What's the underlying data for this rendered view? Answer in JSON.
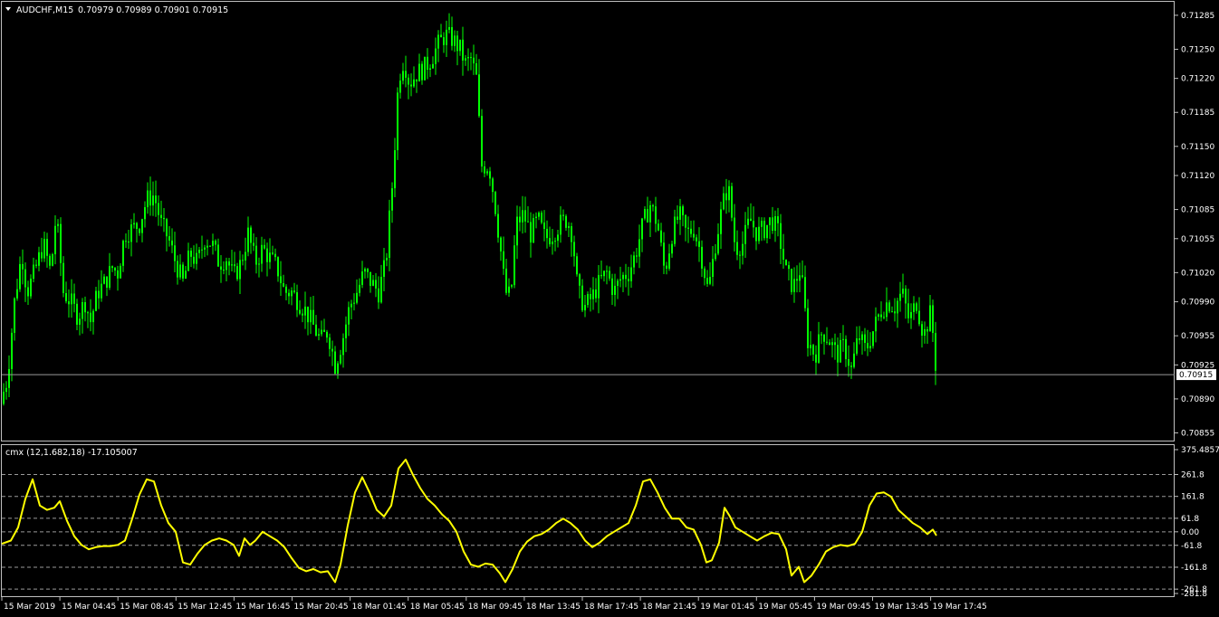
{
  "window": {
    "symbol_title": "AUDCHF,M15",
    "ohlc": "0.70979 0.70989 0.70901 0.70915",
    "indicator_title": "cmx (12,1.682,18) -17.105007"
  },
  "colors": {
    "background": "#000000",
    "candles": "#00ff00",
    "indicator_line": "#ffff00",
    "grid": "#9a9a9a",
    "axis": "#c0c0c0",
    "price_line": "#9a9a9a"
  },
  "chart_data": [
    {
      "type": "candlestick",
      "title": "AUDCHF,M15",
      "current_price": 0.70915,
      "current_price_label": "0.70915",
      "ylim": [
        0.70848,
        0.71297
      ],
      "yticks": [
        "0.71285",
        "0.71250",
        "0.71220",
        "0.71185",
        "0.71150",
        "0.71120",
        "0.71085",
        "0.71055",
        "0.71020",
        "0.70990",
        "0.70955",
        "0.70925",
        "0.70890",
        "0.70855"
      ],
      "xlabels": [
        "15 Mar 2019",
        "15 Mar 04:45",
        "15 Mar 08:45",
        "15 Mar 12:45",
        "15 Mar 16:45",
        "15 Mar 20:45",
        "18 Mar 01:45",
        "18 Mar 05:45",
        "18 Mar 09:45",
        "18 Mar 13:45",
        "18 Mar 17:45",
        "18 Mar 21:45",
        "19 Mar 01:45",
        "19 Mar 05:45",
        "19 Mar 09:45",
        "19 Mar 13:45",
        "19 Mar 17:45"
      ],
      "close_path": [
        [
          0,
          0.70885
        ],
        [
          8,
          0.7091
        ],
        [
          16,
          0.7099
        ],
        [
          24,
          0.7104
        ],
        [
          30,
          0.71
        ],
        [
          38,
          0.7102
        ],
        [
          48,
          0.7105
        ],
        [
          56,
          0.7102
        ],
        [
          62,
          0.7108
        ],
        [
          70,
          0.71
        ],
        [
          78,
          0.7099
        ],
        [
          86,
          0.70975
        ],
        [
          94,
          0.7099
        ],
        [
          100,
          0.7097
        ],
        [
          108,
          0.71
        ],
        [
          116,
          0.7101
        ],
        [
          124,
          0.71025
        ],
        [
          130,
          0.7102
        ],
        [
          138,
          0.7106
        ],
        [
          146,
          0.71065
        ],
        [
          154,
          0.7107
        ],
        [
          162,
          0.71095
        ],
        [
          170,
          0.711
        ],
        [
          178,
          0.7107
        ],
        [
          186,
          0.71055
        ],
        [
          194,
          0.7103
        ],
        [
          202,
          0.7101
        ],
        [
          210,
          0.7104
        ],
        [
          218,
          0.7103
        ],
        [
          226,
          0.71055
        ],
        [
          234,
          0.7105
        ],
        [
          242,
          0.7103
        ],
        [
          250,
          0.71035
        ],
        [
          258,
          0.71015
        ],
        [
          266,
          0.7103
        ],
        [
          274,
          0.7106
        ],
        [
          282,
          0.7103
        ],
        [
          290,
          0.71045
        ],
        [
          298,
          0.71035
        ],
        [
          306,
          0.71025
        ],
        [
          314,
          0.71
        ],
        [
          322,
          0.71
        ],
        [
          330,
          0.7099
        ],
        [
          338,
          0.7098
        ],
        [
          346,
          0.70965
        ],
        [
          354,
          0.7095
        ],
        [
          362,
          0.7096
        ],
        [
          370,
          0.70925
        ],
        [
          378,
          0.7095
        ],
        [
          386,
          0.70985
        ],
        [
          394,
          0.71
        ],
        [
          402,
          0.7102
        ],
        [
          410,
          0.7101
        ],
        [
          418,
          0.71
        ],
        [
          426,
          0.7103
        ],
        [
          434,
          0.7112
        ],
        [
          440,
          0.7122
        ],
        [
          446,
          0.7124
        ],
        [
          452,
          0.71215
        ],
        [
          460,
          0.71225
        ],
        [
          468,
          0.7123
        ],
        [
          476,
          0.7124
        ],
        [
          484,
          0.71255
        ],
        [
          492,
          0.71265
        ],
        [
          500,
          0.7126
        ],
        [
          508,
          0.7125
        ],
        [
          514,
          0.71235
        ],
        [
          520,
          0.7124
        ],
        [
          526,
          0.7122
        ],
        [
          532,
          0.7113
        ],
        [
          540,
          0.7113
        ],
        [
          546,
          0.71095
        ],
        [
          552,
          0.7105
        ],
        [
          558,
          0.71
        ],
        [
          564,
          0.70995
        ],
        [
          570,
          0.7107
        ],
        [
          578,
          0.7108
        ],
        [
          586,
          0.7106
        ],
        [
          594,
          0.71075
        ],
        [
          602,
          0.71055
        ],
        [
          610,
          0.7106
        ],
        [
          618,
          0.7107
        ],
        [
          626,
          0.71075
        ],
        [
          632,
          0.7106
        ],
        [
          638,
          0.71
        ],
        [
          646,
          0.70985
        ],
        [
          654,
          0.70995
        ],
        [
          662,
          0.7101
        ],
        [
          670,
          0.7102
        ],
        [
          678,
          0.71
        ],
        [
          686,
          0.71015
        ],
        [
          694,
          0.7102
        ],
        [
          702,
          0.7104
        ],
        [
          710,
          0.7107
        ],
        [
          718,
          0.7109
        ],
        [
          726,
          0.7107
        ],
        [
          734,
          0.7102
        ],
        [
          742,
          0.7106
        ],
        [
          750,
          0.7108
        ],
        [
          758,
          0.7106
        ],
        [
          766,
          0.71065
        ],
        [
          774,
          0.7104
        ],
        [
          782,
          0.71
        ],
        [
          790,
          0.7105
        ],
        [
          798,
          0.7109
        ],
        [
          804,
          0.7111
        ],
        [
          812,
          0.71045
        ],
        [
          820,
          0.7105
        ],
        [
          828,
          0.71075
        ],
        [
          836,
          0.7106
        ],
        [
          844,
          0.71065
        ],
        [
          852,
          0.71075
        ],
        [
          860,
          0.7106
        ],
        [
          868,
          0.7102
        ],
        [
          876,
          0.71005
        ],
        [
          884,
          0.71025
        ],
        [
          892,
          0.7095
        ],
        [
          900,
          0.70935
        ],
        [
          908,
          0.7096
        ],
        [
          916,
          0.7095
        ],
        [
          924,
          0.70935
        ],
        [
          932,
          0.70945
        ],
        [
          940,
          0.7092
        ],
        [
          948,
          0.70955
        ],
        [
          956,
          0.7094
        ],
        [
          964,
          0.7096
        ],
        [
          972,
          0.7098
        ],
        [
          980,
          0.7099
        ],
        [
          988,
          0.70985
        ],
        [
          996,
          0.71
        ],
        [
          1004,
          0.7097
        ],
        [
          1012,
          0.7099
        ],
        [
          1020,
          0.70955
        ],
        [
          1028,
          0.7098
        ],
        [
          1034,
          0.70915
        ]
      ]
    },
    {
      "type": "line",
      "title": "cmx (12,1.682,18) -17.105007",
      "current_value": -17.105007,
      "ylim": [
        -281.8,
        375.4857
      ],
      "yticks": [
        "375.48570",
        "261.8",
        "161.8",
        "61.8",
        "0.00",
        "-61.8",
        "-161.8",
        "-261.8",
        "-281.8"
      ],
      "levels": [
        261.8,
        161.8,
        61.8,
        0,
        -61.8,
        -161.8,
        -261.8
      ],
      "series": [
        {
          "values": [
            [
              2,
              -55
            ],
            [
              12,
              -40
            ],
            [
              20,
              20
            ],
            [
              28,
              150
            ],
            [
              36,
              240
            ],
            [
              44,
              120
            ],
            [
              52,
              100
            ],
            [
              60,
              110
            ],
            [
              66,
              140
            ],
            [
              74,
              50
            ],
            [
              82,
              -20
            ],
            [
              90,
              -60
            ],
            [
              98,
              -80
            ],
            [
              106,
              -70
            ],
            [
              114,
              -65
            ],
            [
              122,
              -65
            ],
            [
              130,
              -60
            ],
            [
              138,
              -40
            ],
            [
              146,
              60
            ],
            [
              154,
              170
            ],
            [
              162,
              240
            ],
            [
              170,
              230
            ],
            [
              178,
              120
            ],
            [
              186,
              40
            ],
            [
              194,
              0
            ],
            [
              202,
              -140
            ],
            [
              210,
              -150
            ],
            [
              218,
              -100
            ],
            [
              226,
              -60
            ],
            [
              234,
              -40
            ],
            [
              242,
              -30
            ],
            [
              250,
              -40
            ],
            [
              258,
              -60
            ],
            [
              264,
              -110
            ],
            [
              270,
              -30
            ],
            [
              276,
              -60
            ],
            [
              282,
              -40
            ],
            [
              290,
              0
            ],
            [
              298,
              -20
            ],
            [
              306,
              -40
            ],
            [
              314,
              -70
            ],
            [
              322,
              -120
            ],
            [
              330,
              -165
            ],
            [
              338,
              -180
            ],
            [
              346,
              -170
            ],
            [
              354,
              -185
            ],
            [
              362,
              -180
            ],
            [
              370,
              -230
            ],
            [
              376,
              -150
            ],
            [
              384,
              30
            ],
            [
              392,
              180
            ],
            [
              400,
              250
            ],
            [
              408,
              180
            ],
            [
              416,
              100
            ],
            [
              424,
              70
            ],
            [
              432,
              120
            ],
            [
              440,
              290
            ],
            [
              448,
              330
            ],
            [
              456,
              260
            ],
            [
              464,
              200
            ],
            [
              472,
              150
            ],
            [
              480,
              120
            ],
            [
              488,
              80
            ],
            [
              496,
              50
            ],
            [
              504,
              0
            ],
            [
              512,
              -90
            ],
            [
              520,
              -150
            ],
            [
              528,
              -160
            ],
            [
              536,
              -145
            ],
            [
              544,
              -150
            ],
            [
              552,
              -190
            ],
            [
              558,
              -230
            ],
            [
              566,
              -170
            ],
            [
              574,
              -90
            ],
            [
              582,
              -45
            ],
            [
              590,
              -20
            ],
            [
              598,
              -10
            ],
            [
              606,
              10
            ],
            [
              614,
              40
            ],
            [
              622,
              60
            ],
            [
              630,
              40
            ],
            [
              638,
              10
            ],
            [
              646,
              -40
            ],
            [
              654,
              -70
            ],
            [
              662,
              -50
            ],
            [
              670,
              -20
            ],
            [
              678,
              0
            ],
            [
              686,
              20
            ],
            [
              694,
              40
            ],
            [
              702,
              120
            ],
            [
              710,
              230
            ],
            [
              718,
              240
            ],
            [
              726,
              180
            ],
            [
              734,
              110
            ],
            [
              742,
              60
            ],
            [
              750,
              60
            ],
            [
              758,
              20
            ],
            [
              766,
              10
            ],
            [
              774,
              -60
            ],
            [
              780,
              -140
            ],
            [
              786,
              -130
            ],
            [
              794,
              -50
            ],
            [
              800,
              110
            ],
            [
              806,
              70
            ],
            [
              812,
              20
            ],
            [
              820,
              0
            ],
            [
              828,
              -20
            ],
            [
              836,
              -40
            ],
            [
              844,
              -20
            ],
            [
              852,
              -5
            ],
            [
              860,
              -10
            ],
            [
              868,
              -80
            ],
            [
              874,
              -200
            ],
            [
              882,
              -160
            ],
            [
              888,
              -230
            ],
            [
              896,
              -200
            ],
            [
              904,
              -150
            ],
            [
              912,
              -90
            ],
            [
              920,
              -70
            ],
            [
              928,
              -60
            ],
            [
              936,
              -65
            ],
            [
              944,
              -55
            ],
            [
              952,
              0
            ],
            [
              960,
              120
            ],
            [
              968,
              175
            ],
            [
              976,
              180
            ],
            [
              984,
              160
            ],
            [
              992,
              100
            ],
            [
              1000,
              70
            ],
            [
              1008,
              40
            ],
            [
              1016,
              20
            ],
            [
              1024,
              -10
            ],
            [
              1030,
              10
            ],
            [
              1034,
              -17.1
            ]
          ]
        }
      ]
    }
  ]
}
